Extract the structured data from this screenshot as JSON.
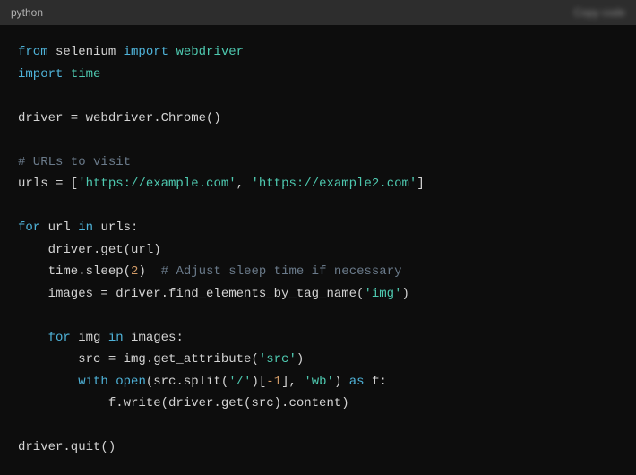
{
  "header": {
    "language": "python",
    "action1": "Copy code",
    "action2": ""
  },
  "code": {
    "l1_from": "from",
    "l1_sel": " selenium ",
    "l1_import": "import",
    "l1_wd": " webdriver",
    "l2_import": "import",
    "l2_time": " time",
    "l4": "driver = webdriver.Chrome()",
    "l6_cmt": "# URLs to visit",
    "l7_a": "urls = [",
    "l7_s1": "'https://example.com'",
    "l7_b": ", ",
    "l7_s2": "'https://example2.com'",
    "l7_c": "]",
    "l9_for": "for",
    "l9_url": " url ",
    "l9_in": "in",
    "l9_urls": " urls:",
    "l10": "    driver.get(url)",
    "l11_a": "    time.sleep(",
    "l11_n": "2",
    "l11_b": ")  ",
    "l11_cmt": "# Adjust sleep time if necessary",
    "l12_a": "    images = driver.find_elements_by_tag_name(",
    "l12_s": "'img'",
    "l12_b": ")",
    "l14_for": "    for",
    "l14_img": " img ",
    "l14_in": "in",
    "l14_images": " images:",
    "l15_a": "        src = img.get_attribute(",
    "l15_s": "'src'",
    "l15_b": ")",
    "l16_with": "        with",
    "l16_sp": " ",
    "l16_open": "open",
    "l16_a": "(src.split(",
    "l16_s1": "'/'",
    "l16_b": ")[",
    "l16_n": "-1",
    "l16_c": "], ",
    "l16_s2": "'wb'",
    "l16_d": ") ",
    "l16_as": "as",
    "l16_e": " f:",
    "l17": "            f.write(driver.get(src).content)",
    "l19": "driver.quit()"
  }
}
